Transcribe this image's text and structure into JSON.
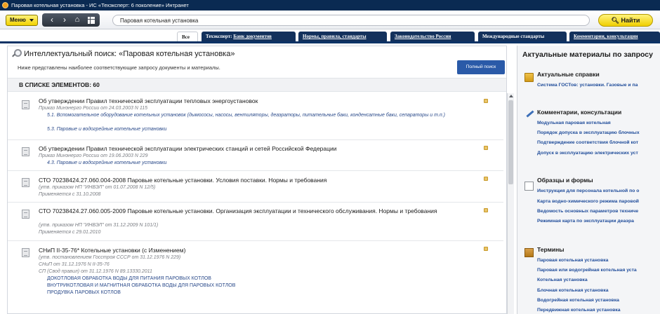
{
  "window": {
    "title": "Паровая котельная установка - ИС «Техэксперт: 6 поколение» Интранет"
  },
  "toolbar": {
    "menu_label": "Меню",
    "search_value": "Паровая котельная установка",
    "find_label": "Найти"
  },
  "tabs": [
    {
      "label": "Все"
    },
    {
      "prefix": "Техэксперт: ",
      "label": "Банк документов"
    },
    {
      "label": "Нормы, правила, стандарты"
    },
    {
      "label": "Законодательство России"
    },
    {
      "label": "Международные стандарты"
    },
    {
      "label": "Комментарии, консультации"
    }
  ],
  "search": {
    "heading": "Интеллектуальный поиск: «Паровая котельная установка»",
    "subheading": "Ниже представлены наиболее соответствующие запросу документы и материалы.",
    "full_search_label": "Полный поиск",
    "count_label": "В СПИСКЕ ЭЛЕМЕНТОВ: 60"
  },
  "results": [
    {
      "title": "Об утверждении Правил технической эксплуатации тепловых энергоустановок",
      "meta": [
        "Приказ Минэнерго России от 24.03.2003 N 115"
      ],
      "links": [
        "5.1. Вспомогательное оборудование котельных установок (дымососы, насосы, вентиляторы, деаэраторы, питательные баки, конденсатные баки, сепараторы и т.п.)",
        "5.3. Паровые и водогрейные котельные установки"
      ]
    },
    {
      "title": "Об утверждении Правил технической эксплуатации электрических станций и сетей Российской Федерации",
      "meta": [
        "Приказ Минэнерго России от 19.06.2003 N 229"
      ],
      "links": [
        "4.3. Паровые и водогрейные котельные установки"
      ]
    },
    {
      "title": "СТО 70238424.27.060.004-2008 Паровые котельные установки. Условия поставки. Нормы и требования",
      "meta": [
        "(утв. приказом НП \"ИНВЭЛ\" от 01.07.2008 N 12/5)",
        "Применяется с 31.10.2008"
      ],
      "links": []
    },
    {
      "title": "СТО 70238424.27.060.005-2009 Паровые котельные установки. Организация эксплуатации и технического обслуживания. Нормы и требования",
      "meta": [
        "(утв. приказом НП \"ИНВЭЛ\" от 31.12.2009 N 101/1)",
        "Применяется с 29.01.2010"
      ],
      "links": []
    },
    {
      "title": "СНиП II-35-76* Котельные установки (с Изменением)",
      "meta": [
        "(утв. постановлением Госстроя СССР от 31.12.1976 N 229)",
        "СНиП от 31.12.1976 N II-35-76",
        "СП (Свод правил) от 31.12.1976 N 89.13330.2011"
      ],
      "links": [
        "ДОКОТЛОВАЯ ОБРАБОТКА ВОДЫ ДЛЯ ПИТАНИЯ ПАРОВЫХ КОТЛОВ",
        "ВНУТРИКОТЛОВАЯ И МАГНИТНАЯ ОБРАБОТКА ВОДЫ ДЛЯ ПАРОВЫХ КОТЛОВ",
        "ПРОДУВКА ПАРОВЫХ КОТЛОВ"
      ]
    }
  ],
  "sidebar": {
    "title": "Актуальные материалы по запросу",
    "sections": [
      {
        "title": "Актуальные справки",
        "icon": "book-icon",
        "links": [
          "Система ГОСТов: установки. Газовые и па"
        ]
      },
      {
        "title": "Комментарии, консультации",
        "icon": "pen-icon",
        "links": [
          "Модульная паровая котельная",
          "Порядок допуска в эксплуатацию блочных",
          "Подтверждение соответствия блочной кот",
          "Допуск в эксплуатацию электрических уст"
        ]
      },
      {
        "title": "Образцы и формы",
        "icon": "form-icon",
        "links": [
          "Инструкция для персонала котельной по о",
          "Карта водно-химического режима паровой",
          "Ведомость основных параметров техниче",
          "Режимная карта по эксплуатации деаэра"
        ]
      },
      {
        "title": "Термины",
        "icon": "terms-icon",
        "links": [
          "Паровая котельная установка",
          "Паровая или водогрейная котельная уста",
          "Котельная установка",
          "Блочная котельная установка",
          "Водогрейная котельная установка",
          "Передвижная котельная установка"
        ]
      }
    ]
  }
}
